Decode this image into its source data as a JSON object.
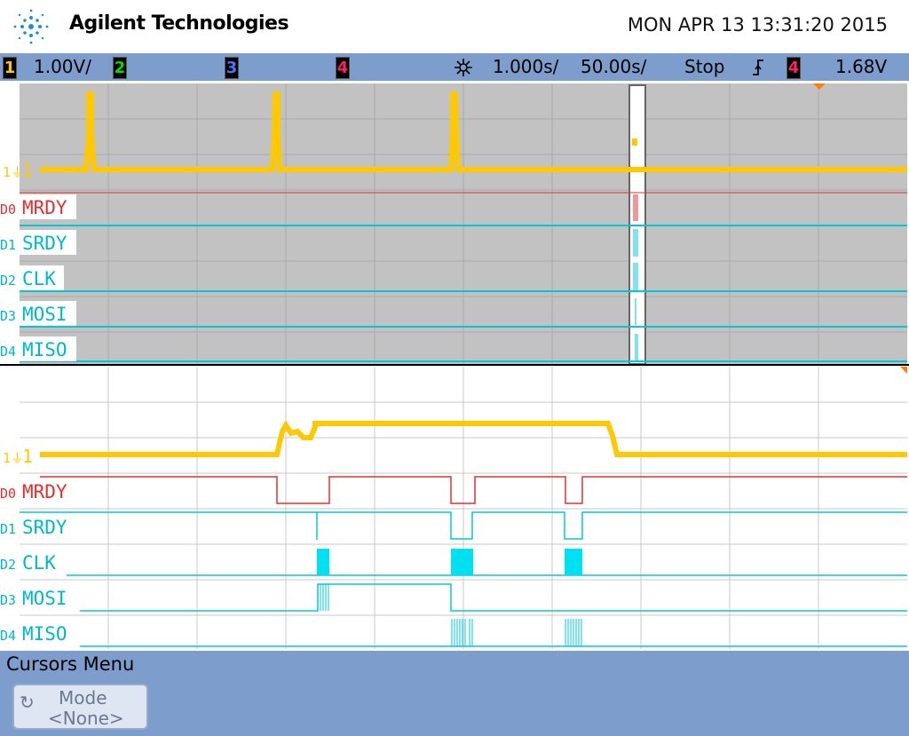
{
  "header": {
    "brand": "Agilent Technologies",
    "datetime": "MON APR 13 13:31:20 2015"
  },
  "status": {
    "ch1_label": "1",
    "ch1_scale": "1.00V/",
    "ch2_label": "2",
    "ch3_label": "3",
    "ch4_label": "4",
    "timebase_delay": "1.000ѕ/",
    "timebase_scale": "50.00ѕ/",
    "run_state": "Stop",
    "trigger_source": "4",
    "trigger_level": "1.68V"
  },
  "colors": {
    "ch1": "#ffc800",
    "ch2": "#00e000",
    "ch3": "#3050ff",
    "ch4": "#ff2060",
    "d0": "#e03030",
    "digital": "#00c8d8",
    "panel": "#7d9dcc",
    "grid_bg_top": "#c0c0c0"
  },
  "traces": {
    "analog_label": "1",
    "d0": "MRDY",
    "d1": "SRDY",
    "d2": "CLK",
    "d3": "MOSI",
    "d4": "MISO",
    "d0_tag": "D0",
    "d1_tag": "D1",
    "d2_tag": "D2",
    "d3_tag": "D3",
    "d4_tag": "D4"
  },
  "menu": {
    "title": "Cursors Menu",
    "mode_label": "Mode",
    "mode_value": "<None>"
  },
  "icons": {
    "brand": "agilent-spark-icon",
    "trigger": "trigger-edge-icon",
    "timebase": "timebase-icon",
    "softkey": "rotate-knob-icon"
  }
}
